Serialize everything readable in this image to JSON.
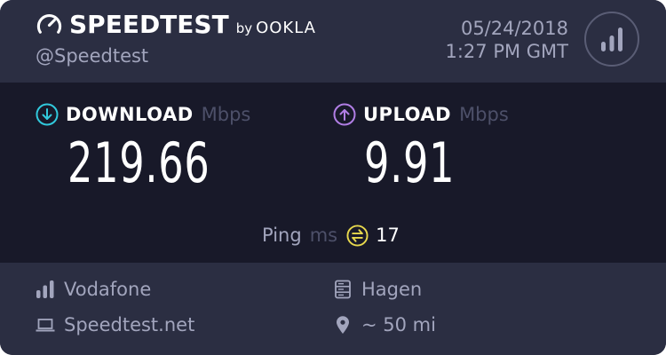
{
  "brand": {
    "name": "SPEEDTEST",
    "by": "by",
    "partner": "OOKLA",
    "icon": "gauge-icon"
  },
  "handle": "@Speedtest",
  "datetime": {
    "date": "05/24/2018",
    "time": "1:27 PM GMT"
  },
  "results_button": {
    "icon": "signal-bars-icon"
  },
  "download": {
    "label": "DOWNLOAD",
    "unit": "Mbps",
    "value": "219.66",
    "icon": "download-arrow-icon",
    "color": "#31c9dc"
  },
  "upload": {
    "label": "UPLOAD",
    "unit": "Mbps",
    "value": "9.91",
    "icon": "upload-arrow-icon",
    "color": "#b17ee5"
  },
  "ping": {
    "label": "Ping",
    "unit": "ms",
    "value": "17",
    "icon": "ping-icon",
    "color": "#e8d94d"
  },
  "footer": {
    "isp": {
      "name": "Vodafone",
      "icon": "signal-bars-icon"
    },
    "host": {
      "name": "Speedtest.net",
      "icon": "laptop-icon"
    },
    "server": {
      "name": "Hagen",
      "icon": "server-icon"
    },
    "distance": {
      "text": "~ 50 mi",
      "icon": "location-pin-icon"
    }
  },
  "colors": {
    "header_bg": "#2b2e42",
    "panel_bg": "#181929",
    "muted_text": "#a2a5bd",
    "unit_text": "#4d5069"
  }
}
